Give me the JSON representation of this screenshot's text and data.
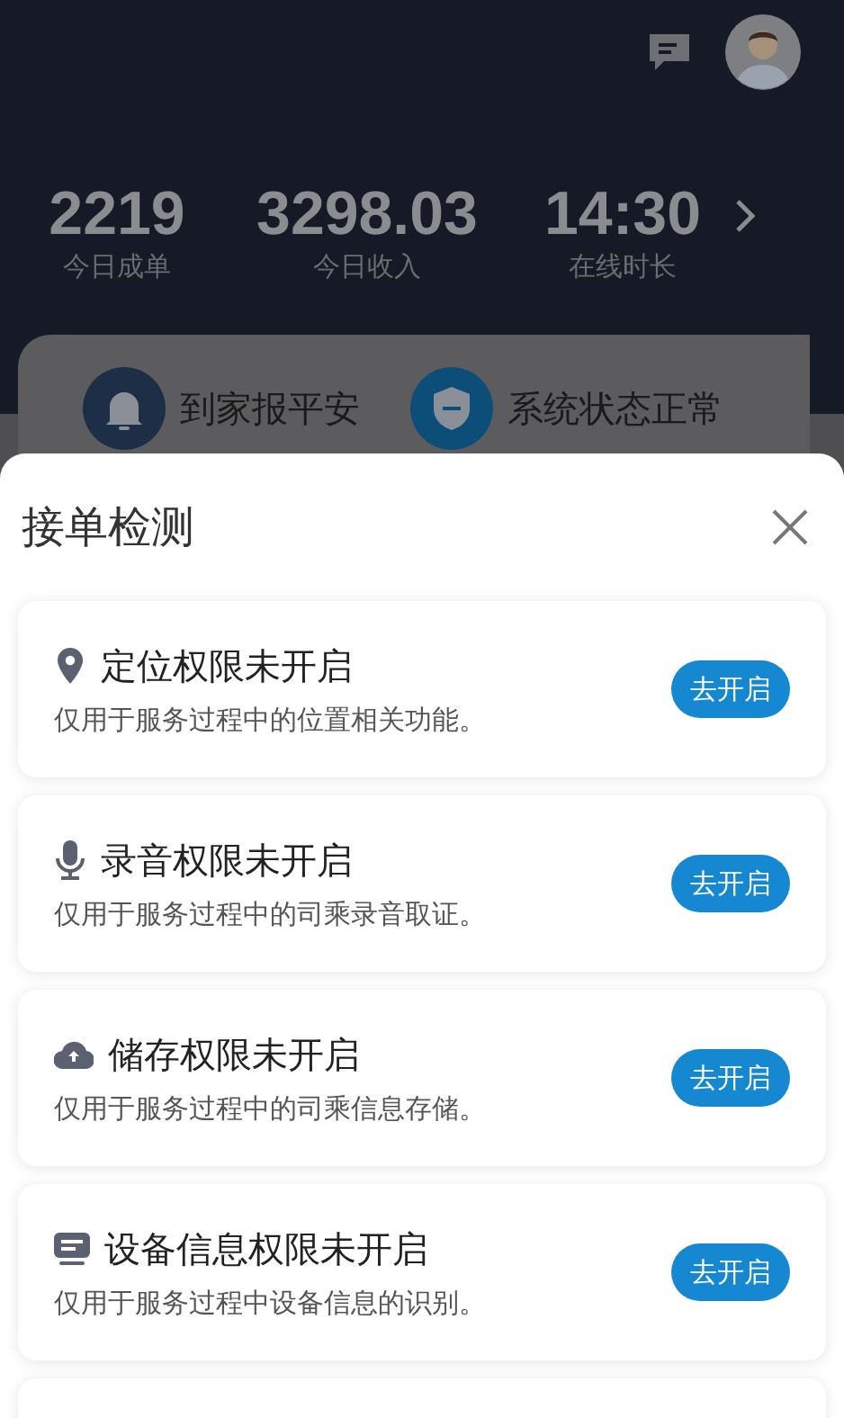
{
  "header": {
    "stats": [
      {
        "value": "2219",
        "label": "今日成单"
      },
      {
        "value": "3298.03",
        "label": "今日收入"
      },
      {
        "value": "14:30",
        "label": "在线时长"
      }
    ]
  },
  "quick_actions": [
    {
      "kind": "bell",
      "label": "到家报平安"
    },
    {
      "kind": "shield",
      "label": "系统状态正常"
    }
  ],
  "sheet": {
    "title": "接单检测",
    "items": [
      {
        "kind": "location",
        "title": "定位权限未开启",
        "description": "仅用于服务过程中的位置相关功能。",
        "button": "去开启"
      },
      {
        "kind": "microphone",
        "title": "录音权限未开启",
        "description": "仅用于服务过程中的司乘录音取证。",
        "button": "去开启"
      },
      {
        "kind": "storage",
        "title": "储存权限未开启",
        "description": "仅用于服务过程中的司乘信息存储。",
        "button": "去开启"
      },
      {
        "kind": "device",
        "title": "设备信息权限未开启",
        "description": "仅用于服务过程中设备信息的识别。",
        "button": "去开启"
      }
    ]
  }
}
